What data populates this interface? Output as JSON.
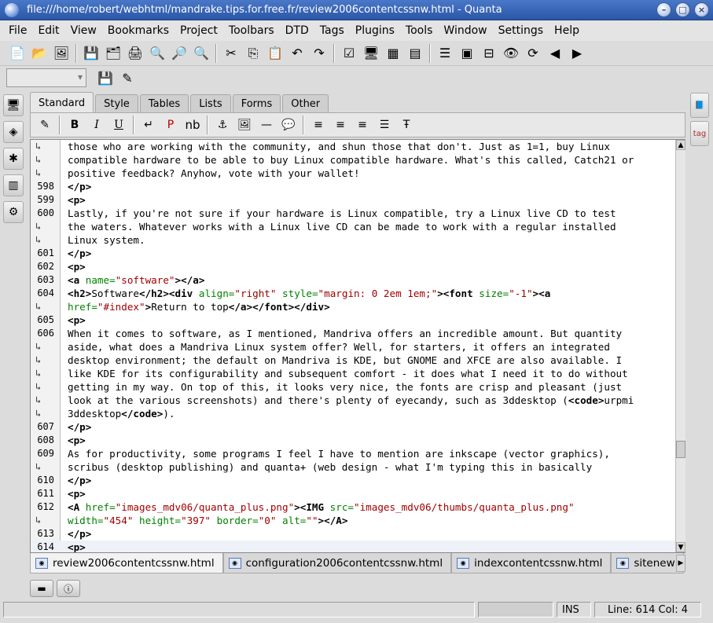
{
  "window": {
    "title": "file:///home/robert/webhtml/mandrake.tips.for.free.fr/review2006contentcssnw.html - Quanta"
  },
  "menu": [
    "File",
    "Edit",
    "View",
    "Bookmarks",
    "Project",
    "Toolbars",
    "DTD",
    "Tags",
    "Plugins",
    "Tools",
    "Window",
    "Settings",
    "Help"
  ],
  "toolbar_tabs": [
    {
      "label": "Standard",
      "active": true
    },
    {
      "label": "Style",
      "active": false
    },
    {
      "label": "Tables",
      "active": false
    },
    {
      "label": "Lists",
      "active": false
    },
    {
      "label": "Forms",
      "active": false
    },
    {
      "label": "Other",
      "active": false
    }
  ],
  "quick_toolbar": {
    "bold": "B",
    "italic": "I",
    "underline": "U",
    "para": "P",
    "nbsp": "nb"
  },
  "editor": {
    "lines": [
      {
        "n": "",
        "wrap": true,
        "html": "those who are working with the community, and shun those that don't. Just as 1=1, buy Linux"
      },
      {
        "n": "",
        "wrap": true,
        "html": "compatible hardware to be able to buy Linux compatible hardware. What's this called, Catch21 or"
      },
      {
        "n": "",
        "wrap": true,
        "html": "positive feedback? Anyhow, vote with your wallet!"
      },
      {
        "n": "598",
        "wrap": false,
        "html": "<span class='tagc'>&lt;/p&gt;</span>"
      },
      {
        "n": "599",
        "wrap": false,
        "html": "<span class='tagc'>&lt;p&gt;</span>"
      },
      {
        "n": "600",
        "wrap": false,
        "html": "Lastly, if you're not sure if your hardware is Linux compatible, try a Linux live CD to test"
      },
      {
        "n": "",
        "wrap": true,
        "html": "the waters. Whatever works with a Linux live CD can be made to work with a regular installed"
      },
      {
        "n": "",
        "wrap": true,
        "html": "Linux system."
      },
      {
        "n": "601",
        "wrap": false,
        "html": "<span class='tagc'>&lt;/p&gt;</span>"
      },
      {
        "n": "602",
        "wrap": false,
        "html": "<span class='tagc'>&lt;p&gt;</span>"
      },
      {
        "n": "603",
        "wrap": false,
        "html": "<span class='tagc'>&lt;a</span> <span class='attr'>name=</span><span class='val'>\"software\"</span><span class='tagc'>&gt;&lt;/a&gt;</span>"
      },
      {
        "n": "604",
        "wrap": false,
        "html": "<span class='tagc'>&lt;h2&gt;</span>Software<span class='tagc'>&lt;/h2&gt;&lt;div</span> <span class='attr'>align=</span><span class='val'>\"right\"</span> <span class='attr'>style=</span><span class='val'>\"margin: 0 2em 1em;\"</span><span class='tagc'>&gt;&lt;font</span> <span class='attr'>size=</span><span class='val'>\"-1\"</span><span class='tagc'>&gt;&lt;a</span>"
      },
      {
        "n": "",
        "wrap": true,
        "html": "<span class='attr'>href=</span><span class='val'>\"#index\"</span><span class='tagc'>&gt;</span>Return to top<span class='tagc'>&lt;/a&gt;&lt;/font&gt;&lt;/div&gt;</span>"
      },
      {
        "n": "605",
        "wrap": false,
        "html": "<span class='tagc'>&lt;p&gt;</span>"
      },
      {
        "n": "606",
        "wrap": false,
        "html": "When it comes to software, as I mentioned, Mandriva offers an incredible amount. But quantity"
      },
      {
        "n": "",
        "wrap": true,
        "html": "aside, what does a Mandriva Linux system offer? Well, for starters, it offers an integrated"
      },
      {
        "n": "",
        "wrap": true,
        "html": "desktop environment; the default on Mandriva is KDE, but GNOME and XFCE are also available. I"
      },
      {
        "n": "",
        "wrap": true,
        "html": "like KDE for its configurability and subsequent comfort - it does what I need it to do without"
      },
      {
        "n": "",
        "wrap": true,
        "html": "getting in my way. On top of this, it looks very nice, the fonts are crisp and pleasant (just"
      },
      {
        "n": "",
        "wrap": true,
        "html": "look at the various screenshots) and there's plenty of eyecandy, such as 3ddesktop (<span class='tagc'>&lt;code&gt;</span>urpmi"
      },
      {
        "n": "",
        "wrap": true,
        "html": "3ddesktop<span class='tagc'>&lt;/code&gt;</span>)."
      },
      {
        "n": "607",
        "wrap": false,
        "html": "<span class='tagc'>&lt;/p&gt;</span>"
      },
      {
        "n": "608",
        "wrap": false,
        "html": "<span class='tagc'>&lt;p&gt;</span>"
      },
      {
        "n": "609",
        "wrap": false,
        "html": "As for productivity, some programs I feel I have to mention are inkscape (vector graphics),"
      },
      {
        "n": "",
        "wrap": true,
        "html": "scribus (desktop publishing) and quanta+ (web design - what I'm typing this in basically"
      },
      {
        "n": "610",
        "wrap": false,
        "html": "<span class='tagc'>&lt;/p&gt;</span>"
      },
      {
        "n": "611",
        "wrap": false,
        "html": "<span class='tagc'>&lt;p&gt;</span>"
      },
      {
        "n": "612",
        "wrap": false,
        "html": "<span class='tagc'>&lt;A</span> <span class='attr'>href=</span><span class='val'>\"images_mdv06/quanta_plus.png\"</span><span class='tagc'>&gt;&lt;IMG</span> <span class='attr'>src=</span><span class='val'>\"images_mdv06/thumbs/quanta_plus.png\"</span>"
      },
      {
        "n": "",
        "wrap": true,
        "html": "<span class='attr'>width=</span><span class='val'>\"454\"</span> <span class='attr'>height=</span><span class='val'>\"397\"</span> <span class='attr'>border=</span><span class='val'>\"0\"</span> <span class='attr'>alt=</span><span class='val'>\"\"</span><span class='tagc'>&gt;&lt;/A&gt;</span>"
      },
      {
        "n": "613",
        "wrap": false,
        "html": "<span class='tagc'>&lt;/p&gt;</span>"
      },
      {
        "n": "614",
        "wrap": false,
        "current": true,
        "html": "<span class='tagc'>&lt;p&gt;</span>"
      }
    ]
  },
  "doc_tabs": [
    {
      "label": "review2006contentcssnw.html",
      "active": true
    },
    {
      "label": "configuration2006contentcssnw.html",
      "active": false
    },
    {
      "label": "indexcontentcssnw.html",
      "active": false
    },
    {
      "label": "sitenew",
      "active": false
    }
  ],
  "status": {
    "mode": "INS",
    "position": "Line: 614 Col: 4"
  }
}
